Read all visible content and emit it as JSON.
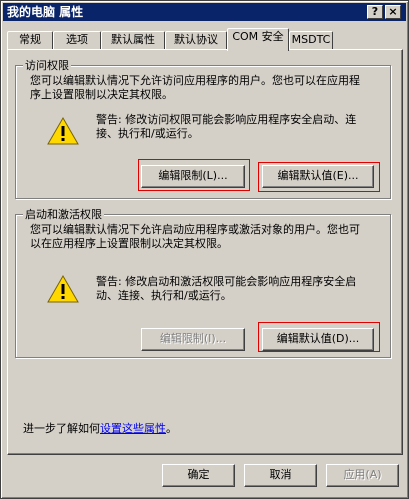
{
  "window": {
    "title": "我的电脑 属性",
    "help_glyph": "?",
    "close_glyph": "×"
  },
  "tabs": [
    {
      "label": "常规"
    },
    {
      "label": "选项"
    },
    {
      "label": "默认属性"
    },
    {
      "label": "默认协议"
    },
    {
      "label": "COM 安全"
    },
    {
      "label": "MSDTC"
    }
  ],
  "active_tab": "COM 安全",
  "access": {
    "title": "访问权限",
    "description": "您可以编辑默认情况下允许访问应用程序的用户。您也可以在应用程序上设置限制以决定其权限。",
    "warning": "警告: 修改访问权限可能会影响应用程序安全启动、连接、执行和/或运行。",
    "edit_limits": "编辑限制(L)...",
    "edit_default": "编辑默认值(E)..."
  },
  "launch": {
    "title": "启动和激活权限",
    "description": "您可以编辑默认情况下允许启动应用程序或激活对象的用户。您也可以在应用程序上设置限制以决定其权限。",
    "warning": "警告: 修改启动和激活权限可能会影响应用程序安全启动、连接、执行和/或运行。",
    "edit_limits": "编辑限制(I)...",
    "edit_default": "编辑默认值(D)..."
  },
  "footer": {
    "learn_prefix": "进一步了解如何",
    "learn_link": "设置这些属性",
    "learn_suffix": "。"
  },
  "buttons": {
    "ok": "确定",
    "cancel": "取消",
    "apply": "应用(A)"
  },
  "colors": {
    "titlebar": "#0a246a",
    "face": "#d4d0c8",
    "highlight_box": "#e00000",
    "link": "#0000ee"
  }
}
